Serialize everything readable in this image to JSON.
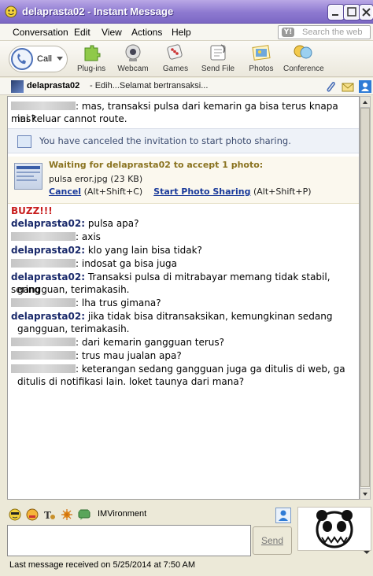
{
  "window": {
    "title": "delaprasta02 - Instant Message"
  },
  "menu": {
    "items": [
      {
        "label": "Conversation"
      },
      {
        "label": "Edit"
      },
      {
        "label": "View"
      },
      {
        "label": "Actions"
      },
      {
        "label": "Help"
      }
    ],
    "search_placeholder": "Search the web"
  },
  "toolbar": {
    "call_label": "Call",
    "tools": [
      {
        "label": "Plug-ins",
        "icon": "plugins-icon"
      },
      {
        "label": "Webcam",
        "icon": "webcam-icon"
      },
      {
        "label": "Games",
        "icon": "games-icon"
      },
      {
        "label": "Send File",
        "icon": "send-file-icon"
      },
      {
        "label": "Photos",
        "icon": "photos-icon"
      },
      {
        "label": "Conference",
        "icon": "conference-icon"
      }
    ]
  },
  "contact": {
    "name": "delaprasta02",
    "status": "- Edih...Selamat bertransaksi..."
  },
  "conversation": {
    "first_message": ": mas, transaksi pulsa dari kemarin ga bisa terus knapa mas?",
    "first_message_cont": "ini keluar cannot route.",
    "notice": "You have canceled the invitation to start photo sharing.",
    "waiting": {
      "title": "Waiting for delaprasta02 to accept 1 photo:",
      "file": "pulsa eror.jpg (23 KB)",
      "cancel_label": "Cancel",
      "cancel_shortcut": "(Alt+Shift+C)",
      "start_label": "Start Photo Sharing",
      "start_shortcut": "(Alt+Shift+P)"
    },
    "buzz": "BUZZ!!!",
    "messages": [
      {
        "sender": "delaprasta02:",
        "text": " pulsa apa?"
      },
      {
        "sender": "",
        "text": ": axis"
      },
      {
        "sender": "delaprasta02:",
        "text": " klo yang lain bisa tidak?"
      },
      {
        "sender": "",
        "text": ": indosat ga bisa juga"
      },
      {
        "sender": "delaprasta02:",
        "text": " Transaksi pulsa di mitrabayar memang tidak stabil, sering",
        "cont": "gangguan, terimakasih."
      },
      {
        "sender": "",
        "text": ": lha trus gimana?"
      },
      {
        "sender": "delaprasta02:",
        "text": " jika tidak bisa ditransaksikan, kemungkinan sedang",
        "cont": "gangguan, terimakasih."
      },
      {
        "sender": "",
        "text": ": dari kemarin gangguan terus?"
      },
      {
        "sender": "",
        "text": ": trus mau jualan apa?"
      },
      {
        "sender": "",
        "text": ": keterangan sedang gangguan juga ga ditulis di web, ga",
        "cont": "ditulis di notifikasi lain. loket taunya dari mana?"
      }
    ]
  },
  "input": {
    "imvironment_label": "IMVironment",
    "send_label": "Send"
  },
  "status": {
    "text": "Last message received on 5/25/2014 at 7:50 AM"
  }
}
